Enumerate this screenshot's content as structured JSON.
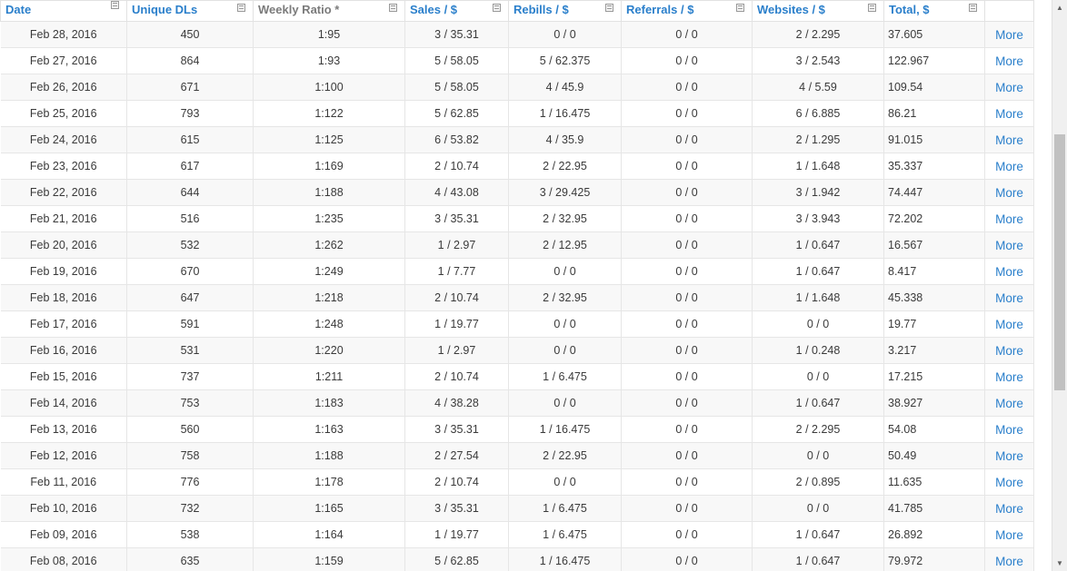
{
  "columns": [
    {
      "label": "Date",
      "sortable": true
    },
    {
      "label": "Unique DLs",
      "sortable": true
    },
    {
      "label": "Weekly Ratio *",
      "sortable": false
    },
    {
      "label": "Sales / $",
      "sortable": true
    },
    {
      "label": "Rebills / $",
      "sortable": true
    },
    {
      "label": "Referrals / $",
      "sortable": true
    },
    {
      "label": "Websites / $",
      "sortable": true
    },
    {
      "label": "Total, $",
      "sortable": true
    },
    {
      "label": "",
      "sortable": false
    }
  ],
  "more_label": "More",
  "rows": [
    [
      "Feb 28, 2016",
      "450",
      "1:95",
      "3 / 35.31",
      "0 / 0",
      "0 / 0",
      "2 / 2.295",
      "37.605"
    ],
    [
      "Feb 27, 2016",
      "864",
      "1:93",
      "5 / 58.05",
      "5 / 62.375",
      "0 / 0",
      "3 / 2.543",
      "122.967"
    ],
    [
      "Feb 26, 2016",
      "671",
      "1:100",
      "5 / 58.05",
      "4 / 45.9",
      "0 / 0",
      "4 / 5.59",
      "109.54"
    ],
    [
      "Feb 25, 2016",
      "793",
      "1:122",
      "5 / 62.85",
      "1 / 16.475",
      "0 / 0",
      "6 / 6.885",
      "86.21"
    ],
    [
      "Feb 24, 2016",
      "615",
      "1:125",
      "6 / 53.82",
      "4 / 35.9",
      "0 / 0",
      "2 / 1.295",
      "91.015"
    ],
    [
      "Feb 23, 2016",
      "617",
      "1:169",
      "2 / 10.74",
      "2 / 22.95",
      "0 / 0",
      "1 / 1.648",
      "35.337"
    ],
    [
      "Feb 22, 2016",
      "644",
      "1:188",
      "4 / 43.08",
      "3 / 29.425",
      "0 / 0",
      "3 / 1.942",
      "74.447"
    ],
    [
      "Feb 21, 2016",
      "516",
      "1:235",
      "3 / 35.31",
      "2 / 32.95",
      "0 / 0",
      "3 / 3.943",
      "72.202"
    ],
    [
      "Feb 20, 2016",
      "532",
      "1:262",
      "1 / 2.97",
      "2 / 12.95",
      "0 / 0",
      "1 / 0.647",
      "16.567"
    ],
    [
      "Feb 19, 2016",
      "670",
      "1:249",
      "1 / 7.77",
      "0 / 0",
      "0 / 0",
      "1 / 0.647",
      "8.417"
    ],
    [
      "Feb 18, 2016",
      "647",
      "1:218",
      "2 / 10.74",
      "2 / 32.95",
      "0 / 0",
      "1 / 1.648",
      "45.338"
    ],
    [
      "Feb 17, 2016",
      "591",
      "1:248",
      "1 / 19.77",
      "0 / 0",
      "0 / 0",
      "0 / 0",
      "19.77"
    ],
    [
      "Feb 16, 2016",
      "531",
      "1:220",
      "1 / 2.97",
      "0 / 0",
      "0 / 0",
      "1 / 0.248",
      "3.217"
    ],
    [
      "Feb 15, 2016",
      "737",
      "1:211",
      "2 / 10.74",
      "1 / 6.475",
      "0 / 0",
      "0 / 0",
      "17.215"
    ],
    [
      "Feb 14, 2016",
      "753",
      "1:183",
      "4 / 38.28",
      "0 / 0",
      "0 / 0",
      "1 / 0.647",
      "38.927"
    ],
    [
      "Feb 13, 2016",
      "560",
      "1:163",
      "3 / 35.31",
      "1 / 16.475",
      "0 / 0",
      "2 / 2.295",
      "54.08"
    ],
    [
      "Feb 12, 2016",
      "758",
      "1:188",
      "2 / 27.54",
      "2 / 22.95",
      "0 / 0",
      "0 / 0",
      "50.49"
    ],
    [
      "Feb 11, 2016",
      "776",
      "1:178",
      "2 / 10.74",
      "0 / 0",
      "0 / 0",
      "2 / 0.895",
      "11.635"
    ],
    [
      "Feb 10, 2016",
      "732",
      "1:165",
      "3 / 35.31",
      "1 / 6.475",
      "0 / 0",
      "0 / 0",
      "41.785"
    ],
    [
      "Feb 09, 2016",
      "538",
      "1:164",
      "1 / 19.77",
      "1 / 6.475",
      "0 / 0",
      "1 / 0.647",
      "26.892"
    ],
    [
      "Feb 08, 2016",
      "635",
      "1:159",
      "5 / 62.85",
      "1 / 16.475",
      "0 / 0",
      "1 / 0.647",
      "79.972"
    ]
  ],
  "colors": {
    "accent": "#2a7fcb",
    "header_muted": "#7b7b7b",
    "row_alt": "#f8f8f8",
    "border": "#e6e6e6"
  },
  "icons": {
    "column_sort": "sort-icon",
    "scroll_up": "scroll-up-arrow-icon",
    "scroll_down": "scroll-down-arrow-icon"
  }
}
